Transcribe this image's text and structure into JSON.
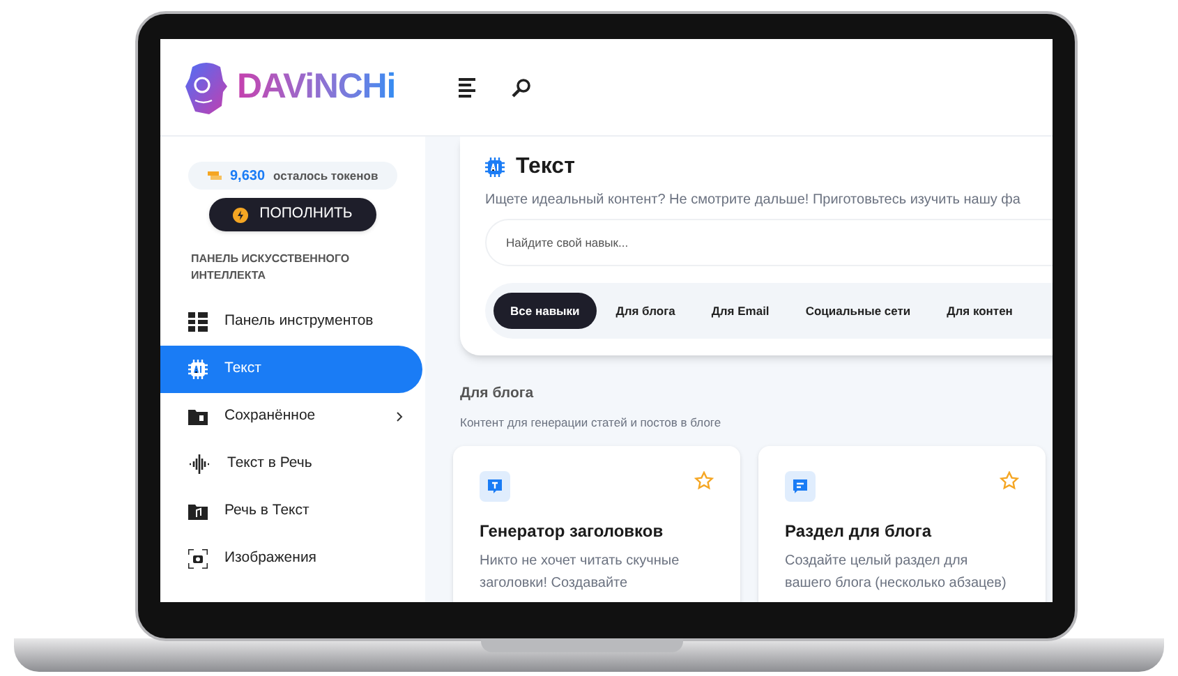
{
  "brand": {
    "name": "DAViNCHi"
  },
  "tokens": {
    "count": "9,630",
    "label": "осталось токенов"
  },
  "topup_button": "ПОПОЛНИТЬ",
  "sidebar": {
    "section_title": "ПАНЕЛЬ ИСКУССТВЕННОГО ИНТЕЛЛЕКТА",
    "items": [
      {
        "label": "Панель инструментов",
        "kind": "grid",
        "selected": false,
        "has_submenu": false
      },
      {
        "label": "Текст",
        "kind": "ai",
        "selected": true,
        "has_submenu": false
      },
      {
        "label": "Сохранённое",
        "kind": "folder",
        "selected": false,
        "has_submenu": true
      },
      {
        "label": "Текст в Речь",
        "kind": "wave",
        "selected": false,
        "has_submenu": false
      },
      {
        "label": "Речь в Текст",
        "kind": "music",
        "selected": false,
        "has_submenu": false
      },
      {
        "label": "Изображения",
        "kind": "camera",
        "selected": false,
        "has_submenu": false
      }
    ]
  },
  "page": {
    "title": "Текст",
    "subtitle": "Ищете идеальный контент? Не смотрите дальше! Приготовьтесь изучить нашу фа",
    "search": {
      "placeholder": "Найдите свой навык..."
    },
    "tabs": [
      {
        "label": "Все навыки",
        "selected": true
      },
      {
        "label": "Для блога",
        "selected": false
      },
      {
        "label": "Для Email",
        "selected": false
      },
      {
        "label": "Социальные сети",
        "selected": false
      },
      {
        "label": "Для контен",
        "selected": false
      }
    ]
  },
  "section": {
    "title": "Для блога",
    "subtitle": "Контент для генерации статей и постов в блоге",
    "cards": [
      {
        "kind": "title",
        "title": "Генератор заголовков",
        "description": "Никто не хочет читать скучные заголовки! Создавайте"
      },
      {
        "kind": "paragraph",
        "title": "Раздел для блога",
        "description": "Создайте целый раздел для вашего блога (несколько абзацев)"
      }
    ]
  }
}
